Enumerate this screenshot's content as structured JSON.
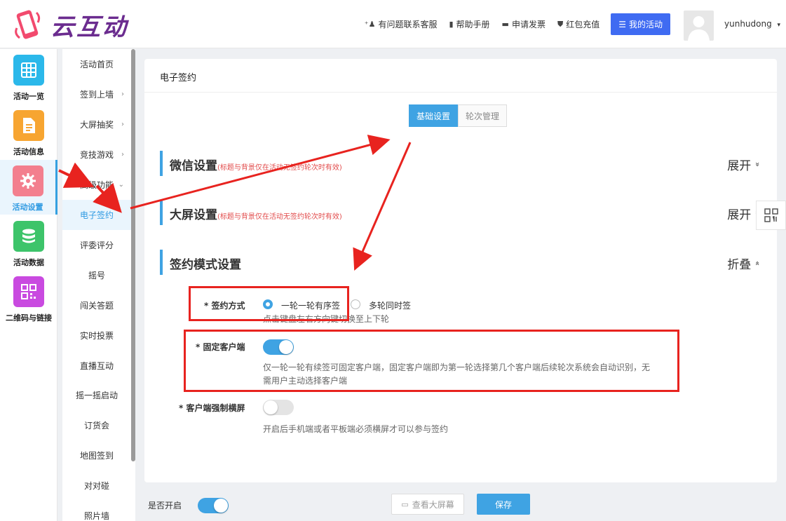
{
  "header": {
    "logo_text": "云互动",
    "links": [
      {
        "icon": "person-add-icon",
        "glyph": "⁺👤",
        "label": "有问题联系客服"
      },
      {
        "icon": "book-icon",
        "glyph": "▮",
        "label": "帮助手册"
      },
      {
        "icon": "printer-icon",
        "glyph": "▬",
        "label": "申请发票"
      },
      {
        "icon": "shield-check-icon",
        "glyph": "✔",
        "label": "红包充值"
      }
    ],
    "my_activity_label": "我的活动",
    "username": "yunhudong"
  },
  "nav1": [
    {
      "label": "活动一览",
      "icon": "grid-icon",
      "color": "#2bb8ea"
    },
    {
      "label": "活动信息",
      "icon": "document-icon",
      "color": "#f7a531"
    },
    {
      "label": "活动设置",
      "icon": "gear-icon",
      "color": "#f37f8e"
    },
    {
      "label": "活动数据",
      "icon": "database-icon",
      "color": "#3dc46a"
    },
    {
      "label": "二维码与链接",
      "icon": "qrcode-icon",
      "color": "#c94ae0"
    }
  ],
  "nav2": [
    {
      "label": "活动首页",
      "chevron": ""
    },
    {
      "label": "签到上墙",
      "chevron": "›"
    },
    {
      "label": "大屏抽奖",
      "chevron": "›"
    },
    {
      "label": "竞技游戏",
      "chevron": "›"
    },
    {
      "label": "高级功能",
      "chevron": "⌄"
    },
    {
      "label": "电子签约",
      "chevron": ""
    },
    {
      "label": "评委评分",
      "chevron": ""
    },
    {
      "label": "摇号",
      "chevron": ""
    },
    {
      "label": "闯关答题",
      "chevron": ""
    },
    {
      "label": "实时投票",
      "chevron": ""
    },
    {
      "label": "直播互动",
      "chevron": ""
    },
    {
      "label": "摇一摇启动",
      "chevron": ""
    },
    {
      "label": "订货会",
      "chevron": ""
    },
    {
      "label": "地图签到",
      "chevron": ""
    },
    {
      "label": "对对碰",
      "chevron": ""
    },
    {
      "label": "照片墙",
      "chevron": ""
    }
  ],
  "main": {
    "title": "电子签约",
    "tabs": [
      "基础设置",
      "轮次管理"
    ],
    "sections": [
      {
        "title": "微信设置",
        "note": "(标题与背景仅在活动无签约轮次时有效)",
        "toggle": "展开",
        "arrow": "»"
      },
      {
        "title": "大屏设置",
        "note": "(标题与背景仅在活动无签约轮次时有效)",
        "toggle": "展开",
        "arrow": "»"
      },
      {
        "title": "签约模式设置",
        "note": "",
        "toggle": "折叠",
        "arrow": "«"
      }
    ],
    "sign_mode": {
      "label": "* 签约方式",
      "option1": "一轮一轮有序签",
      "option2": "多轮同时签",
      "hint": "点击键盘左右方向键切换至上下轮"
    },
    "fixed_client": {
      "label": "* 固定客户端",
      "hint_line1": "仅一轮一轮有续签可固定客户端，固定客户端即为第一轮选择第几个客户端后续轮次系统会自动识别，无",
      "hint_line2": "需用户主动选择客户端"
    },
    "force_landscape": {
      "label": "* 客户端强制横屏",
      "hint": "开启后手机端或者平板端必须横屏才可以参与签约"
    }
  },
  "footer": {
    "enable_label": "是否开启",
    "view_screen_label": "查看大屏幕",
    "save_label": "保存"
  },
  "colors": {
    "accent": "#3fa3e3",
    "annotation": "#e8231f",
    "brand": "#6b2c8f"
  }
}
